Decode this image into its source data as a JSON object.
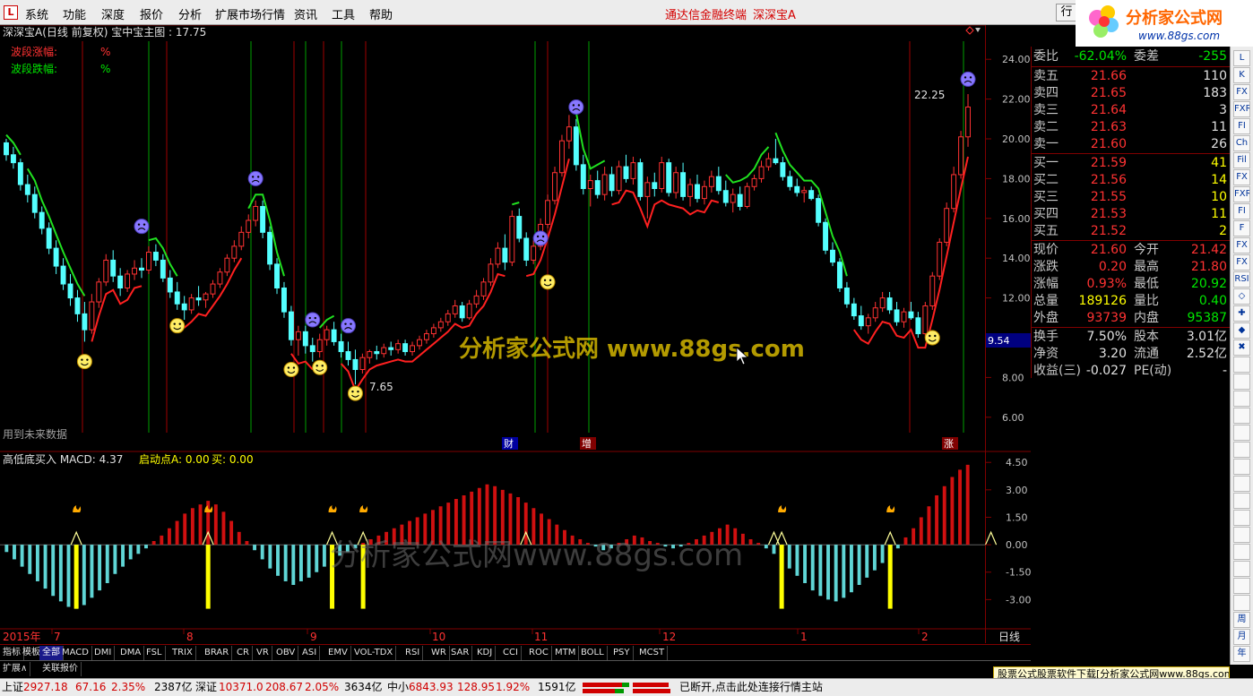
{
  "menu": {
    "items": [
      "系统",
      "功能",
      "深度",
      "报价",
      "分析",
      "扩展市场行情",
      "资讯",
      "工具",
      "帮助"
    ],
    "center_left": "通达信金融终端",
    "center_right": "深深宝A",
    "row_button": "行",
    "brand_text": "分析家公式网",
    "brand_url": "www.88gs.com"
  },
  "main_chart": {
    "title": "深深宝A(日线 前复权) 宝中宝主图 : 17.75",
    "legend_up": "波段涨幅:",
    "legend_up_unit": "%",
    "legend_down": "波段跌幅:",
    "legend_down_unit": "%",
    "future_data_note": "用到未来数据",
    "y_ticks": [
      "24.00",
      "22.00",
      "20.00",
      "18.00",
      "16.00",
      "14.00",
      "12.00",
      "10.00",
      "8.00",
      "6.00"
    ],
    "current_price_tag": "9.54",
    "high_label": "22.25",
    "low_label": "7.65",
    "event_markers": [
      "财",
      "增",
      "涨"
    ],
    "watermark": "分析家公式网  www.88gs.com"
  },
  "sub_chart": {
    "title": "高低底买入  MACD: 4.37",
    "qidong_label": "启动点A: 0.00",
    "mai_label": "买: 0.00",
    "y_ticks": [
      "4.50",
      "3.00",
      "1.50",
      "0.00",
      "-1.50",
      "-3.00"
    ],
    "watermark": "分析家公式网www.88gs.com"
  },
  "time_axis": {
    "labels": [
      "2015年",
      "7",
      "8",
      "9",
      "10",
      "11",
      "12",
      "1",
      "2"
    ],
    "period": "日线",
    "zoom_buttons": [
      "+",
      "-",
      "0"
    ]
  },
  "quote": {
    "weibi_label": "委比",
    "weibi": "-62.04%",
    "weicha_label": "委差",
    "weicha": "-255",
    "asks": [
      {
        "label": "卖五",
        "price": "21.66",
        "vol": "110"
      },
      {
        "label": "卖四",
        "price": "21.65",
        "vol": "183"
      },
      {
        "label": "卖三",
        "price": "21.64",
        "vol": "3"
      },
      {
        "label": "卖二",
        "price": "21.63",
        "vol": "11"
      },
      {
        "label": "卖一",
        "price": "21.60",
        "vol": "26"
      }
    ],
    "bids": [
      {
        "label": "买一",
        "price": "21.59",
        "vol": "41"
      },
      {
        "label": "买二",
        "price": "21.56",
        "vol": "14"
      },
      {
        "label": "买三",
        "price": "21.55",
        "vol": "10"
      },
      {
        "label": "买四",
        "price": "21.53",
        "vol": "11"
      },
      {
        "label": "买五",
        "price": "21.52",
        "vol": "2"
      }
    ],
    "stats": [
      {
        "l1": "现价",
        "v1": "21.60",
        "c1": "red",
        "l2": "今开",
        "v2": "21.42",
        "c2": "red"
      },
      {
        "l1": "涨跌",
        "v1": "0.20",
        "c1": "red",
        "l2": "最高",
        "v2": "21.80",
        "c2": "red"
      },
      {
        "l1": "涨幅",
        "v1": "0.93%",
        "c1": "red",
        "l2": "最低",
        "v2": "20.92",
        "c2": "green"
      },
      {
        "l1": "总量",
        "v1": "189126",
        "c1": "yellow",
        "l2": "量比",
        "v2": "0.40",
        "c2": "green"
      },
      {
        "l1": "外盘",
        "v1": "93739",
        "c1": "red",
        "l2": "内盘",
        "v2": "95387",
        "c2": "green"
      }
    ],
    "finance": [
      {
        "l1": "换手",
        "v1": "7.50%",
        "l2": "股本",
        "v2": "3.01亿"
      },
      {
        "l1": "净资",
        "v1": "3.20",
        "l2": "流通",
        "v2": "2.52亿"
      },
      {
        "l1": "收益(三)",
        "v1": "-0.027",
        "l2": "PE(动)",
        "v2": "-"
      }
    ]
  },
  "toolbar": {
    "buttons": [
      "L",
      "K",
      "FX",
      "FXR",
      "FI",
      "Ch",
      "Fil",
      "FX",
      "FXR",
      "FI",
      "F",
      "FX",
      "FX",
      "RSI",
      "◇",
      "✚",
      "◆",
      "✖",
      "",
      "",
      "",
      "",
      "",
      "",
      "",
      "",
      "",
      "",
      "",
      "",
      "",
      "",
      "",
      "周",
      "月",
      "年"
    ]
  },
  "tabs": [
    "指标",
    "模板",
    "全部",
    "MACD",
    "DMI",
    "DMA",
    "FSL",
    "TRIX",
    "BRAR",
    "CR",
    "VR",
    "OBV",
    "ASI",
    "EMV",
    "VOL-TDX",
    "RSI",
    "WR",
    "SAR",
    "KDJ",
    "CCI",
    "ROC",
    "MTM",
    "BOLL",
    "PSY",
    "MCST"
  ],
  "subtabs": [
    "扩展∧",
    "关联报价"
  ],
  "ad_text": "股票公式股票软件下载[分析家公式网www.88gs.com]",
  "status": {
    "sh_label": "上证",
    "sh_val": "2927.18",
    "sh_chg": "67.16",
    "sh_pct": "2.35%",
    "sh_amt": "2387亿",
    "sz_label": "深证",
    "sz_val": "10371.0",
    "sz_chg": "208.67",
    "sz_pct": "2.05%",
    "sz_amt": "3634亿",
    "zx_label": "中小",
    "zx_val": "6843.93",
    "zx_chg": "128.95",
    "zx_pct": "1.92%",
    "zx_amt": "1591亿",
    "conn": "已断开,点击此处连接行情主站"
  },
  "colors": {
    "up": "#ff3232",
    "down": "#54ffff",
    "grid": "#800000",
    "axis": "#c0c0c0"
  },
  "chart_data": {
    "type": "candlestick",
    "price_ylim": [
      5.0,
      25.0
    ],
    "macd_ylim": [
      -4.5,
      5.0
    ],
    "ohlc": [
      [
        19.8,
        20.0,
        18.9,
        19.2
      ],
      [
        19.2,
        19.6,
        18.5,
        18.8
      ],
      [
        18.8,
        19.0,
        17.4,
        17.7
      ],
      [
        17.7,
        18.2,
        16.8,
        17.2
      ],
      [
        17.2,
        17.6,
        16.0,
        16.3
      ],
      [
        16.3,
        16.6,
        15.2,
        15.5
      ],
      [
        15.5,
        15.8,
        14.2,
        14.5
      ],
      [
        14.5,
        14.9,
        13.2,
        13.6
      ],
      [
        13.6,
        14.0,
        12.4,
        12.7
      ],
      [
        12.7,
        13.2,
        11.6,
        12.0
      ],
      [
        12.0,
        12.4,
        10.8,
        11.2
      ],
      [
        11.2,
        11.8,
        9.8,
        10.4
      ],
      [
        10.4,
        12.2,
        10.2,
        11.8
      ],
      [
        11.8,
        13.0,
        11.5,
        12.8
      ],
      [
        12.8,
        14.2,
        12.6,
        13.9
      ],
      [
        13.9,
        14.4,
        12.8,
        13.1
      ],
      [
        13.1,
        13.5,
        12.1,
        12.5
      ],
      [
        12.5,
        13.4,
        12.3,
        13.2
      ],
      [
        13.2,
        13.9,
        12.9,
        13.5
      ],
      [
        13.5,
        14.0,
        13.0,
        13.4
      ],
      [
        13.4,
        14.6,
        13.2,
        14.3
      ],
      [
        14.3,
        14.7,
        13.6,
        13.9
      ],
      [
        13.9,
        14.2,
        12.8,
        13.0
      ],
      [
        13.0,
        13.4,
        12.0,
        12.3
      ],
      [
        12.3,
        12.8,
        11.4,
        11.7
      ],
      [
        11.7,
        12.1,
        10.9,
        11.4
      ],
      [
        11.4,
        12.2,
        11.2,
        12.0
      ],
      [
        12.0,
        12.6,
        11.6,
        11.9
      ],
      [
        11.9,
        12.3,
        11.5,
        12.2
      ],
      [
        12.2,
        12.9,
        12.0,
        12.7
      ],
      [
        12.7,
        13.5,
        12.5,
        13.3
      ],
      [
        13.3,
        14.2,
        13.1,
        14.0
      ],
      [
        14.0,
        14.9,
        13.8,
        14.6
      ],
      [
        14.6,
        15.6,
        14.4,
        15.3
      ],
      [
        15.3,
        16.2,
        15.0,
        15.9
      ],
      [
        15.9,
        16.9,
        15.6,
        16.6
      ],
      [
        16.6,
        16.9,
        15.0,
        15.3
      ],
      [
        15.3,
        15.6,
        13.4,
        13.7
      ],
      [
        13.7,
        14.0,
        12.2,
        12.5
      ],
      [
        12.5,
        12.8,
        11.0,
        11.3
      ],
      [
        11.3,
        11.6,
        9.6,
        9.9
      ],
      [
        9.9,
        10.6,
        9.1,
        10.3
      ],
      [
        10.3,
        10.6,
        9.2,
        9.6
      ],
      [
        9.6,
        10.0,
        8.8,
        9.3
      ],
      [
        9.3,
        10.2,
        9.0,
        9.9
      ],
      [
        9.9,
        10.6,
        9.6,
        10.4
      ],
      [
        10.4,
        10.8,
        9.6,
        9.8
      ],
      [
        9.8,
        10.2,
        9.0,
        9.3
      ],
      [
        9.3,
        9.8,
        8.6,
        8.9
      ],
      [
        8.9,
        9.4,
        7.65,
        8.4
      ],
      [
        8.4,
        9.2,
        8.2,
        9.0
      ],
      [
        9.0,
        9.4,
        8.7,
        9.3
      ],
      [
        9.3,
        9.6,
        8.9,
        9.2
      ],
      [
        9.2,
        9.7,
        9.0,
        9.5
      ],
      [
        9.5,
        9.8,
        9.1,
        9.4
      ],
      [
        9.4,
        9.9,
        9.2,
        9.7
      ],
      [
        9.7,
        9.9,
        9.1,
        9.3
      ],
      [
        9.3,
        9.8,
        9.1,
        9.6
      ],
      [
        9.6,
        10.1,
        9.4,
        9.9
      ],
      [
        9.9,
        10.4,
        9.7,
        10.2
      ],
      [
        10.2,
        10.7,
        10.0,
        10.5
      ],
      [
        10.5,
        11.0,
        10.3,
        10.8
      ],
      [
        10.8,
        11.4,
        10.6,
        11.2
      ],
      [
        11.2,
        11.9,
        11.0,
        11.6
      ],
      [
        11.6,
        11.8,
        10.8,
        11.0
      ],
      [
        11.0,
        11.9,
        10.9,
        11.7
      ],
      [
        11.7,
        12.4,
        11.5,
        12.1
      ],
      [
        12.1,
        13.0,
        11.9,
        12.8
      ],
      [
        12.8,
        14.0,
        12.6,
        13.7
      ],
      [
        13.7,
        14.8,
        13.5,
        14.5
      ],
      [
        14.5,
        15.2,
        13.4,
        13.8
      ],
      [
        13.8,
        16.4,
        13.6,
        16.1
      ],
      [
        16.1,
        16.5,
        14.8,
        15.0
      ],
      [
        15.0,
        15.3,
        13.6,
        13.9
      ],
      [
        13.9,
        14.9,
        13.7,
        14.6
      ],
      [
        14.6,
        16.0,
        14.4,
        15.7
      ],
      [
        15.7,
        17.2,
        15.5,
        16.9
      ],
      [
        16.9,
        18.6,
        16.7,
        18.3
      ],
      [
        18.3,
        20.2,
        18.1,
        19.9
      ],
      [
        19.9,
        21.2,
        19.5,
        20.6
      ],
      [
        20.6,
        21.0,
        18.4,
        18.7
      ],
      [
        18.7,
        19.2,
        17.2,
        17.5
      ],
      [
        17.5,
        18.2,
        16.6,
        17.9
      ],
      [
        17.9,
        18.4,
        17.0,
        17.2
      ],
      [
        17.2,
        18.6,
        16.9,
        18.2
      ],
      [
        18.2,
        18.6,
        17.1,
        17.4
      ],
      [
        17.4,
        18.9,
        17.2,
        18.6
      ],
      [
        18.6,
        19.2,
        17.8,
        18.0
      ],
      [
        18.0,
        19.1,
        17.7,
        18.8
      ],
      [
        18.8,
        19.0,
        16.9,
        17.1
      ],
      [
        17.1,
        18.1,
        16.0,
        17.8
      ],
      [
        17.8,
        18.3,
        17.1,
        17.5
      ],
      [
        17.5,
        19.1,
        17.3,
        18.8
      ],
      [
        18.8,
        19.0,
        17.1,
        17.3
      ],
      [
        17.3,
        18.6,
        17.0,
        18.3
      ],
      [
        18.3,
        18.8,
        16.9,
        17.1
      ],
      [
        17.1,
        18.0,
        16.6,
        17.7
      ],
      [
        17.7,
        18.2,
        16.8,
        17.0
      ],
      [
        17.0,
        17.9,
        16.7,
        17.6
      ],
      [
        17.6,
        18.4,
        17.3,
        18.1
      ],
      [
        18.1,
        18.6,
        17.2,
        17.4
      ],
      [
        17.4,
        17.9,
        16.6,
        16.8
      ],
      [
        16.8,
        17.5,
        16.3,
        17.2
      ],
      [
        17.2,
        17.6,
        16.4,
        16.6
      ],
      [
        16.6,
        17.8,
        16.5,
        17.6
      ],
      [
        17.6,
        18.2,
        17.4,
        18.0
      ],
      [
        18.0,
        18.9,
        17.8,
        18.6
      ],
      [
        18.6,
        19.3,
        18.4,
        19.0
      ],
      [
        19.0,
        20.0,
        18.7,
        18.8
      ],
      [
        18.8,
        19.1,
        17.9,
        18.1
      ],
      [
        18.1,
        18.4,
        17.4,
        17.6
      ],
      [
        17.6,
        18.0,
        17.1,
        17.3
      ],
      [
        17.3,
        17.6,
        16.8,
        17.4
      ],
      [
        17.4,
        17.6,
        16.9,
        17.0
      ],
      [
        17.0,
        17.2,
        15.6,
        15.8
      ],
      [
        15.8,
        16.0,
        14.2,
        14.4
      ],
      [
        14.4,
        14.8,
        13.6,
        13.8
      ],
      [
        13.8,
        14.0,
        12.3,
        12.5
      ],
      [
        12.5,
        12.8,
        11.5,
        11.7
      ],
      [
        11.7,
        12.0,
        10.9,
        11.1
      ],
      [
        11.1,
        11.6,
        10.4,
        10.6
      ],
      [
        10.6,
        11.2,
        10.2,
        11.0
      ],
      [
        11.0,
        11.8,
        10.8,
        11.5
      ],
      [
        11.5,
        12.3,
        11.3,
        12.0
      ],
      [
        12.0,
        12.3,
        11.2,
        11.4
      ],
      [
        11.4,
        11.8,
        10.6,
        10.8
      ],
      [
        10.8,
        11.5,
        10.5,
        11.3
      ],
      [
        11.3,
        11.8,
        10.9,
        11.0
      ],
      [
        11.0,
        11.3,
        10.0,
        10.2
      ],
      [
        10.2,
        11.8,
        10.0,
        11.6
      ],
      [
        11.6,
        13.3,
        11.4,
        13.1
      ],
      [
        13.1,
        15.0,
        12.9,
        14.8
      ],
      [
        14.8,
        16.8,
        14.6,
        16.5
      ],
      [
        16.5,
        18.6,
        16.3,
        18.2
      ],
      [
        18.2,
        20.4,
        18.0,
        20.1
      ],
      [
        20.1,
        22.25,
        19.6,
        21.6
      ]
    ],
    "macd_hist": [
      -0.4,
      -0.8,
      -1.2,
      -1.6,
      -2.0,
      -2.4,
      -2.8,
      -3.1,
      -3.4,
      -3.5,
      -3.3,
      -2.9,
      -2.5,
      -2.1,
      -1.6,
      -1.2,
      -0.8,
      -0.5,
      -0.2,
      0.2,
      0.5,
      0.9,
      1.3,
      1.7,
      2.0,
      2.2,
      2.4,
      2.2,
      1.8,
      1.3,
      0.7,
      0.2,
      -0.3,
      -0.8,
      -1.3,
      -1.7,
      -2.0,
      -2.2,
      -2.0,
      -1.8,
      -1.5,
      -1.2,
      -0.9,
      -0.6,
      -0.4,
      -0.2,
      0.1,
      0.3,
      0.5,
      0.7,
      0.9,
      1.1,
      1.3,
      1.5,
      1.7,
      1.9,
      2.1,
      2.3,
      2.5,
      2.7,
      2.9,
      3.1,
      3.3,
      3.2,
      3.0,
      2.8,
      2.6,
      2.3,
      2.0,
      1.7,
      1.4,
      1.1,
      0.8,
      0.5,
      0.3,
      0.1,
      -0.1,
      -0.3,
      -0.2,
      0.1,
      0.3,
      0.5,
      0.4,
      0.2,
      0.1,
      -0.1,
      -0.2,
      -0.1,
      0.1,
      0.3,
      0.5,
      0.7,
      0.9,
      1.1,
      0.9,
      0.6,
      0.3,
      0.1,
      -0.2,
      -0.5,
      -0.9,
      -1.3,
      -1.7,
      -2.1,
      -2.5,
      -2.8,
      -3.0,
      -3.1,
      -2.9,
      -2.6,
      -2.2,
      -1.8,
      -1.4,
      -1.0,
      -0.6,
      -0.2,
      0.4,
      0.9,
      1.5,
      2.1,
      2.7,
      3.2,
      3.7,
      4.1,
      4.37
    ]
  }
}
